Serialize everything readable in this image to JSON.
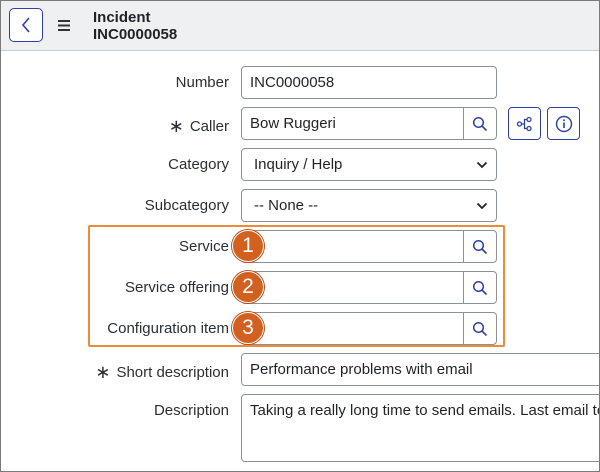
{
  "header": {
    "title_line1": "Incident",
    "title_line2": "INC0000058"
  },
  "form": {
    "number": {
      "label": "Number",
      "value": "INC0000058"
    },
    "caller": {
      "label": "Caller",
      "required_mark": "∗",
      "value": "Bow Ruggeri"
    },
    "category": {
      "label": "Category",
      "value": "Inquiry / Help"
    },
    "subcategory": {
      "label": "Subcategory",
      "value": "-- None --"
    },
    "service": {
      "label": "Service",
      "value": ""
    },
    "service_offering": {
      "label": "Service offering",
      "value": ""
    },
    "configuration_item": {
      "label": "Configuration item",
      "value": ""
    },
    "short_description": {
      "label": "Short description",
      "required_mark": "∗",
      "value": "Performance problems with email"
    },
    "description": {
      "label": "Description",
      "value": "Taking a really long time to send emails. Last email too"
    }
  },
  "annotations": [
    "1",
    "2",
    "3"
  ],
  "colors": {
    "accent": "#2f3fa3",
    "callout": "#d2601f",
    "highlight_border": "#ec8b3a"
  }
}
